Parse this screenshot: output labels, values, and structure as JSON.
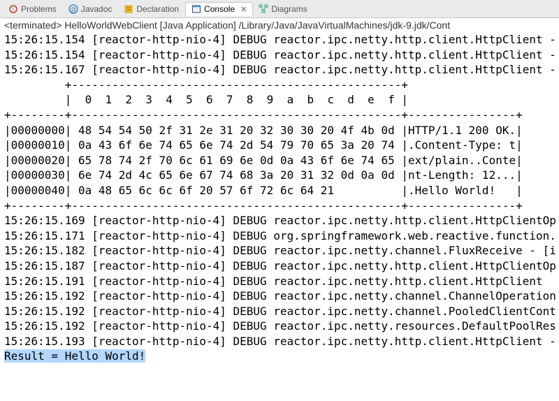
{
  "tabs": [
    {
      "label": "Problems",
      "icon": "problems-icon"
    },
    {
      "label": "Javadoc",
      "icon": "javadoc-icon"
    },
    {
      "label": "Declaration",
      "icon": "declaration-icon"
    },
    {
      "label": "Console",
      "icon": "console-icon",
      "active": true,
      "closable": true
    },
    {
      "label": "Diagrams",
      "icon": "diagrams-icon"
    }
  ],
  "status_line": "<terminated> HelloWorldWebClient [Java Application] /Library/Java/JavaVirtualMachines/jdk-9.jdk/Cont",
  "console_lines": [
    "15:26:15.154 [reactor-http-nio-4] DEBUG reactor.ipc.netty.http.client.HttpClient -",
    "15:26:15.154 [reactor-http-nio-4] DEBUG reactor.ipc.netty.http.client.HttpClient -",
    "15:26:15.167 [reactor-http-nio-4] DEBUG reactor.ipc.netty.http.client.HttpClient -",
    "         +-------------------------------------------------+",
    "         |  0  1  2  3  4  5  6  7  8  9  a  b  c  d  e  f |",
    "+--------+-------------------------------------------------+----------------+",
    "|00000000| 48 54 54 50 2f 31 2e 31 20 32 30 30 20 4f 4b 0d |HTTP/1.1 200 OK.|",
    "|00000010| 0a 43 6f 6e 74 65 6e 74 2d 54 79 70 65 3a 20 74 |.Content-Type: t|",
    "|00000020| 65 78 74 2f 70 6c 61 69 6e 0d 0a 43 6f 6e 74 65 |ext/plain..Conte|",
    "|00000030| 6e 74 2d 4c 65 6e 67 74 68 3a 20 31 32 0d 0a 0d |nt-Length: 12...|",
    "|00000040| 0a 48 65 6c 6c 6f 20 57 6f 72 6c 64 21          |.Hello World!   |",
    "+--------+-------------------------------------------------+----------------+",
    "15:26:15.169 [reactor-http-nio-4] DEBUG reactor.ipc.netty.http.client.HttpClientOp",
    "15:26:15.171 [reactor-http-nio-4] DEBUG org.springframework.web.reactive.function.",
    "15:26:15.182 [reactor-http-nio-4] DEBUG reactor.ipc.netty.channel.FluxReceive - [i",
    "15:26:15.187 [reactor-http-nio-4] DEBUG reactor.ipc.netty.http.client.HttpClientOp",
    "15:26:15.191 [reactor-http-nio-4] DEBUG reactor.ipc.netty.http.client.HttpClient",
    "15:26:15.192 [reactor-http-nio-4] DEBUG reactor.ipc.netty.channel.ChannelOperation",
    "15:26:15.192 [reactor-http-nio-4] DEBUG reactor.ipc.netty.channel.PooledClientCont",
    "15:26:15.192 [reactor-http-nio-4] DEBUG reactor.ipc.netty.resources.DefaultPoolRes",
    "15:26:15.193 [reactor-http-nio-4] DEBUG reactor.ipc.netty.http.client.HttpClient -"
  ],
  "result_line": "Result = Hello World!"
}
